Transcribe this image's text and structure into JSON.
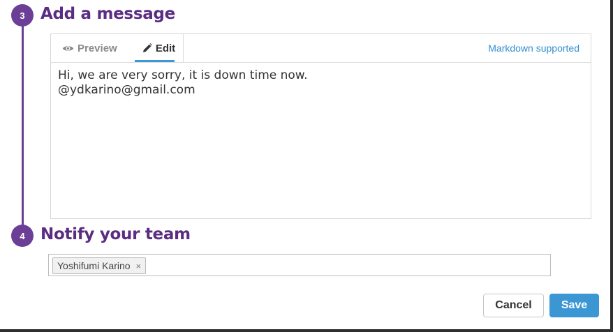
{
  "steps": [
    {
      "number": "3",
      "title": "Add a message"
    },
    {
      "number": "4",
      "title": "Notify your team"
    }
  ],
  "editor": {
    "tabs": {
      "preview": "Preview",
      "edit": "Edit"
    },
    "active_tab": "Edit",
    "markdown_link": "Markdown supported",
    "message_lines": [
      "Hi,  we are very sorry, it is down time now.",
      "@ydkarino@gmail.com"
    ]
  },
  "notify": {
    "recipients": [
      "Yoshifumi Karino"
    ],
    "remove_symbol": "×"
  },
  "actions": {
    "cancel": "Cancel",
    "save": "Save"
  },
  "icons": {
    "preview_tab": "eye-icon",
    "edit_tab": "pencil-icon",
    "chip_remove": "close-icon"
  },
  "colors": {
    "step": "#6c3f96",
    "step_title": "#5a2d82",
    "link": "#2f8fcf",
    "save": "#3a97d4",
    "active_tab_underline": "#3c9bd6"
  }
}
